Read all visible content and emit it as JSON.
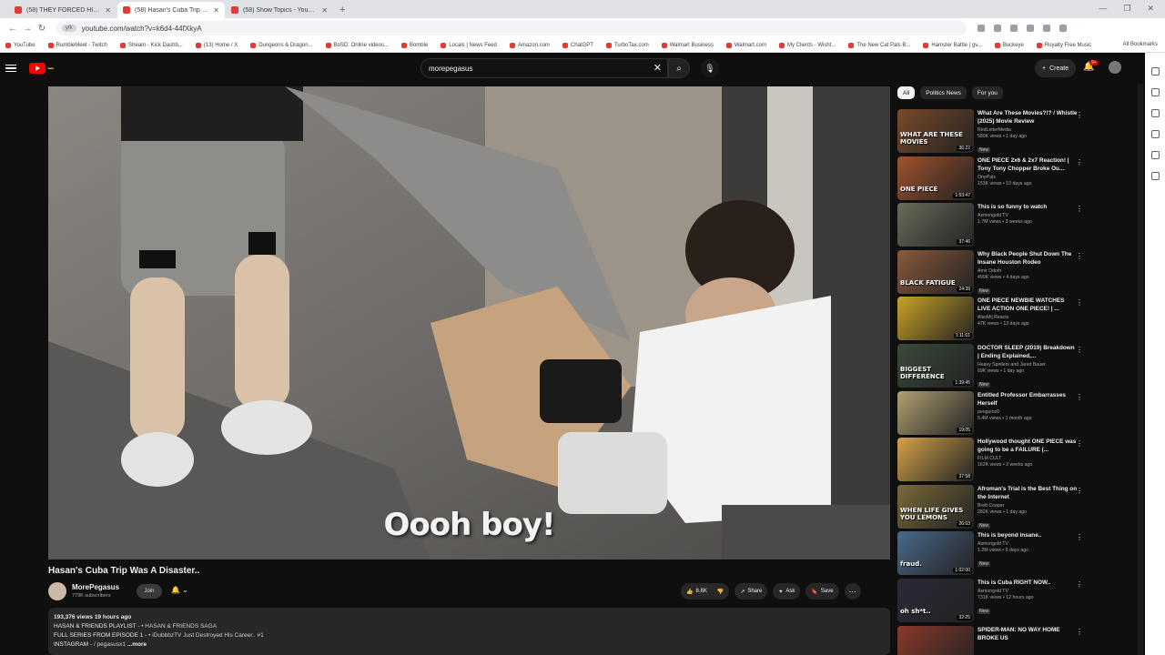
{
  "browser": {
    "tabs": [
      {
        "label": "(58) THEY FORCED HIS F*CKIN",
        "active": false
      },
      {
        "label": "(58) Hasan's Cuba Trip Wa...",
        "active": true
      },
      {
        "label": "(58) Show Topics - YouTube",
        "active": false
      }
    ],
    "site_badge": "yfk",
    "url": "youtube.com/watch?v=k6d4-44fXkyA",
    "bookmarks": [
      "YouTube",
      "RumbleMeet - Twitch",
      "Stream - Kick Dashb...",
      "(13) Home / X",
      "Dungeons & Dragon...",
      "BoSD: Online videos...",
      "Bomble",
      "Locals | News Feed",
      "Amazon.com",
      "ChatGPT",
      "TurboTax.com",
      "Walmart Business",
      "Walmart.com",
      "My Clients - Wisht...",
      "The New Cat Pals B...",
      "Hamster Battle | gv...",
      "Buckeye",
      "Royalty Free Music"
    ],
    "all_bookmarks": "All Bookmarks"
  },
  "header": {
    "search_value": "morepegasus",
    "create_label": "Create",
    "notif_count": "9+"
  },
  "video": {
    "caption": "Oooh boy!",
    "title": "Hasan's Cuba Trip Was A Disaster..",
    "channel": "MorePegasus",
    "subscribers": "779K subscribers",
    "join_label": "Join",
    "likes": "8.6K",
    "share_label": "Share",
    "ask_label": "Ask",
    "save_label": "Save"
  },
  "description": {
    "stats": "193,376 views  19 hours ago",
    "line1": "HASAN & FRIENDS PLAYLIST - ",
    "line1b": "• HASAN & FRIENDS SAGA",
    "line2": "FULL SERIES FROM EPISODE 1 - ",
    "line2b": "• iDubbbzTV Just Destroyed His Career.. #1",
    "line3": "INSTAGRAM - ",
    "line3b": "/ pegasusx1",
    "more": "...more"
  },
  "chips": [
    "All",
    "Politics News",
    "For you"
  ],
  "recommendations": [
    {
      "title": "What Are These Movies?!? / Whistle (2025) Movie Review",
      "channel": "RedLetterMedia",
      "meta": "580K views • 1 day ago",
      "new": "New",
      "duration": "36:22",
      "thumb_text": "WHAT ARE THESE MOVIES",
      "color": "#7a4a2a"
    },
    {
      "title": "ONE PIECE 2x6 & 2x7 Reaction! | Tony Tony Chopper Broke Ou...",
      "channel": "OnePals",
      "meta": "153K views • 10 days ago",
      "new": "",
      "duration": "1:53:47",
      "thumb_text": "ONE PIECE",
      "color": "#a0522d"
    },
    {
      "title": "This is so funny to watch",
      "channel": "Asmongold TV",
      "meta": "1.7M views • 3 weeks ago",
      "new": "",
      "duration": "37:46",
      "thumb_text": "",
      "color": "#6b6b5a"
    },
    {
      "title": "Why Black People Shut Down The Insane Houston Rodeo",
      "channel": "Amir Odom",
      "meta": "490K views • 4 days ago",
      "new": "New",
      "duration": "24:39",
      "thumb_text": "BLACK FATIGUE",
      "color": "#8b5a3c"
    },
    {
      "title": "ONE PIECE NEWBIE WATCHES LIVE ACTION ONE PIECE! | ...",
      "channel": "AlsoMij Reacts",
      "meta": "47K views • 13 days ago",
      "new": "",
      "duration": "1:11:01",
      "thumb_text": "",
      "color": "#c9a227"
    },
    {
      "title": "DOCTOR SLEEP (2019) Breakdown | Ending Explained,...",
      "channel": "Heavy Spoilers  and Jared Bauer",
      "meta": "69K views • 1 day ago",
      "new": "New",
      "duration": "1:39:45",
      "thumb_text": "BIGGEST DIFFERENCE",
      "color": "#3a4a3a"
    },
    {
      "title": "Entitled Professor Embarrasses Herself",
      "channel": "penguinz0",
      "meta": "5.4M views • 1 month ago",
      "new": "",
      "duration": "19:05",
      "thumb_text": "",
      "color": "#b0a070"
    },
    {
      "title": "Hollywood thought ONE PIECE was going to be a FAILURE (...",
      "channel": "FILM CULT",
      "meta": "162K views • 2 weeks ago",
      "new": "",
      "duration": "37:58",
      "thumb_text": "",
      "color": "#d4a24a"
    },
    {
      "title": "Afroman's Trial is the Best Thing on the Internet",
      "channel": "Brett Cooper",
      "meta": "282K views • 1 day ago",
      "new": "New",
      "duration": "26:03",
      "thumb_text": "WHEN LIFE GIVES YOU LEMONS",
      "color": "#7a6a3a"
    },
    {
      "title": "This is beyond insane..",
      "channel": "Asmongold TV",
      "meta": "1.2M views • 5 days ago",
      "new": "New",
      "duration": "1:02:00",
      "thumb_text": "fraud.",
      "color": "#4a6a8a"
    },
    {
      "title": "This is Cuba RIGHT NOW..",
      "channel": "Asmongold TV",
      "meta": "731K views • 12 hours ago",
      "new": "New",
      "duration": "32:25",
      "thumb_text": "oh sh*t..",
      "color": "#2a2a3a"
    },
    {
      "title": "SPIDER-MAN: NO WAY HOME BROKE US",
      "channel": "",
      "meta": "",
      "new": "",
      "duration": "",
      "thumb_text": "",
      "color": "#8a3a2a"
    }
  ]
}
